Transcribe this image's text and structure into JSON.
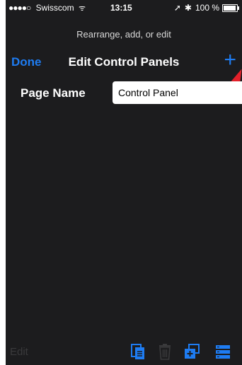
{
  "status_bar": {
    "signal": "●●●●○",
    "carrier": "Swisscom",
    "wifi": "ᯤ",
    "time": "13:15",
    "location": "➚",
    "bluetooth": "✱",
    "battery": "100 %",
    "battery_level": 1.0
  },
  "prompt": "Rearrange, add, or edit",
  "navbar": {
    "done_label": "Done",
    "title": "Edit Control Panels",
    "add_label": "+"
  },
  "form": {
    "label": "Page Name",
    "value": "Control Panel"
  },
  "toolbar": {
    "edit_label": "Edit",
    "icons": [
      "copy-page-icon",
      "trash-icon",
      "add-stack-icon",
      "list-icon"
    ]
  },
  "colors": {
    "background": "#1c1c1e",
    "accent": "#1e7cf2",
    "disabled": "#3a3a3c",
    "cursor": "#e3202a"
  }
}
